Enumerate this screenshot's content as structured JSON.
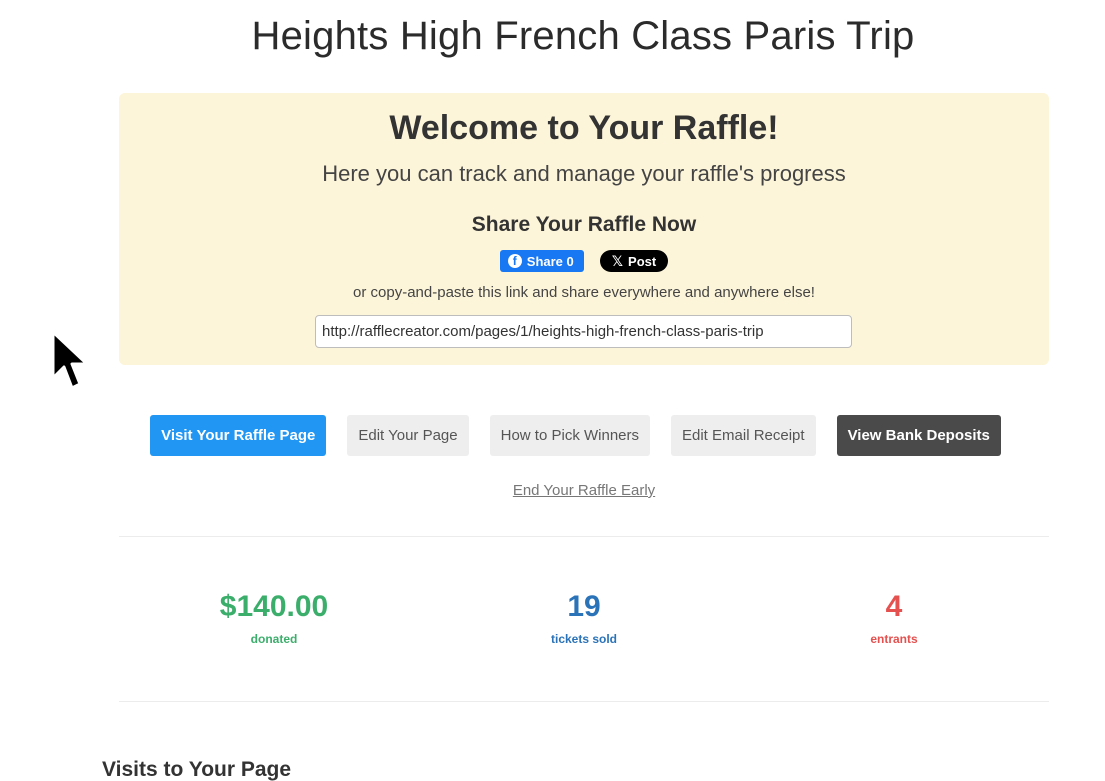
{
  "page": {
    "title": "Heights High French Class Paris Trip"
  },
  "welcome": {
    "heading": "Welcome to Your Raffle!",
    "subheading": "Here you can track and manage your raffle's progress",
    "share_heading": "Share Your Raffle Now",
    "fb_share_label": "Share 0",
    "x_post_label": "Post",
    "copy_text": "or copy-and-paste this link and share everywhere and anywhere else!",
    "link_value": "http://rafflecreator.com/pages/1/heights-high-french-class-paris-trip"
  },
  "actions": {
    "visit_label": "Visit Your Raffle Page",
    "edit_label": "Edit Your Page",
    "pick_winners_label": "How to Pick Winners",
    "edit_receipt_label": "Edit Email Receipt",
    "bank_deposits_label": "View Bank Deposits",
    "end_early_label": "End Your Raffle Early"
  },
  "stats": {
    "donated_value": "$140.00",
    "donated_label": "donated",
    "tickets_value": "19",
    "tickets_label": "tickets sold",
    "entrants_value": "4",
    "entrants_label": "entrants"
  },
  "sections": {
    "visits_heading": "Visits to Your Page"
  },
  "colors": {
    "panel_bg": "#fdf5d9",
    "primary": "#2196f3",
    "dark_button": "#4a4a4a",
    "donated": "#3cae6b",
    "tickets": "#2a73b8",
    "entrants": "#e4514f",
    "facebook": "#1877f2"
  },
  "icons": [
    "facebook-icon",
    "x-icon",
    "mouse-cursor-icon"
  ]
}
